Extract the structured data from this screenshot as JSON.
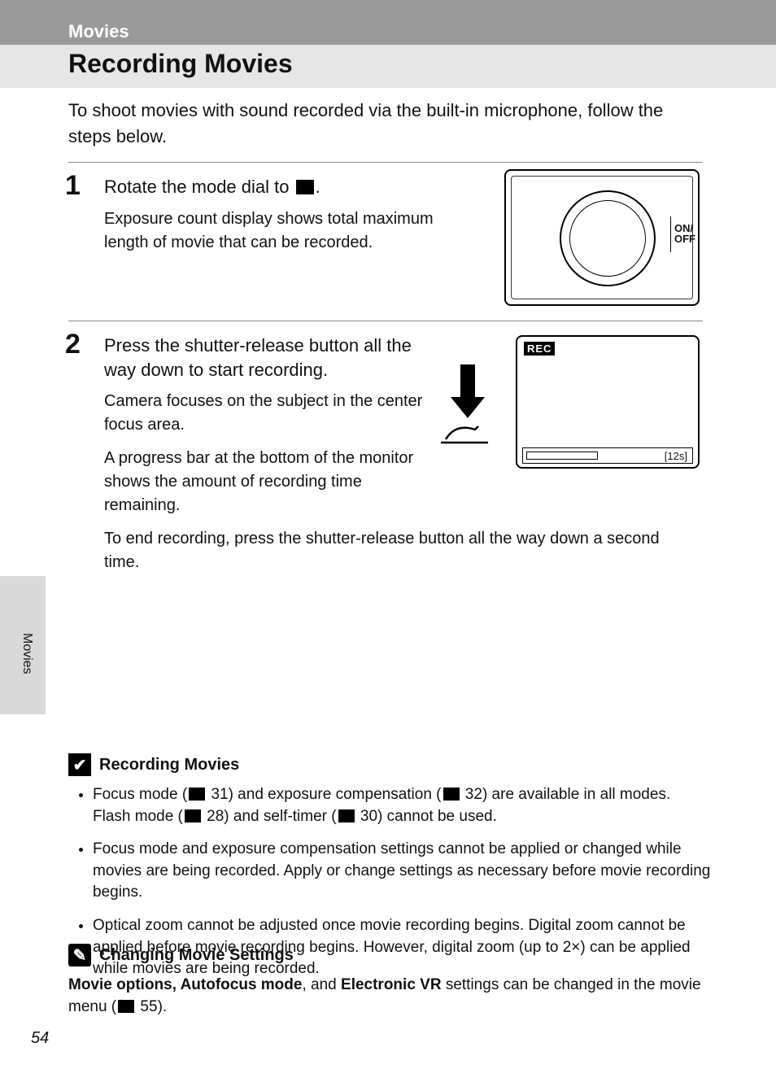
{
  "section": "Movies",
  "title": "Recording Movies",
  "intro": "To shoot movies with sound recorded via the built-in microphone, follow the steps below.",
  "steps": [
    {
      "num": "1",
      "head_pre": "Rotate the mode dial to ",
      "head_post": ".",
      "body": [
        "Exposure count display shows total maximum length of movie that can be recorded."
      ]
    },
    {
      "num": "2",
      "head": "Press the shutter-release button all the way down to start recording.",
      "body": [
        "Camera focuses on the subject in the center focus area.",
        "A progress bar at the bottom of the monitor shows the amount of recording time remaining.",
        "To end recording, press the shutter-release button all the way down a second time."
      ]
    }
  ],
  "illus": {
    "onoff": "ON/\nOFF",
    "rec": "REC",
    "timecode": "12s"
  },
  "notes": [
    {
      "icon": "✔",
      "title": "Recording Movies",
      "bullets": [
        {
          "pre": "Focus mode (",
          "ref1": "31",
          "mid": ") and exposure compensation (",
          "ref2": "32",
          "post": ") are available in all modes. Flash mode (",
          "ref3": "28",
          "mid2": ") and self-timer (",
          "ref4": "30",
          "end": ") cannot be used."
        },
        {
          "text": "Focus mode and exposure compensation settings cannot be applied or changed while movies are being recorded. Apply or change settings as necessary before movie recording begins."
        },
        {
          "text": "Optical zoom cannot be adjusted once movie recording begins. Digital zoom cannot be applied before movie recording begins. However, digital zoom (up to 2×) can be applied while movies are being recorded."
        }
      ]
    },
    {
      "icon": "✎",
      "title": "Changing Movie Settings",
      "para_pre": "Movie options, Autofocus mode",
      "para_mid": ", and ",
      "para_bold2": "Electronic VR",
      "para_post": " settings can be changed in the movie menu (",
      "ref": "55",
      "para_end": ")."
    }
  ],
  "sideLabel": "Movies",
  "pageNumber": "54"
}
